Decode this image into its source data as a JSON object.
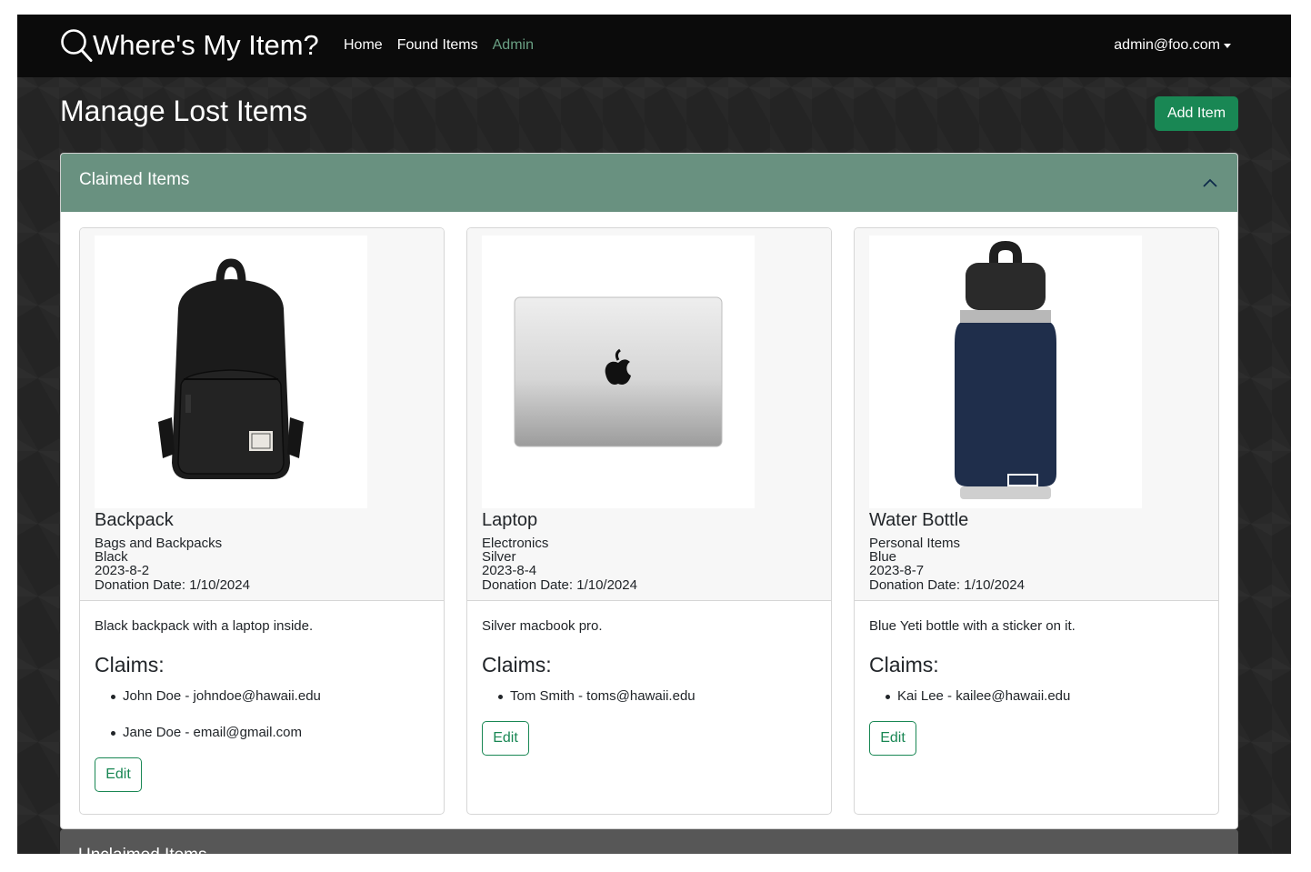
{
  "navbar": {
    "brand": "Where's My Item?",
    "brand_icon": "search-icon",
    "links": [
      {
        "label": "Home",
        "active": false
      },
      {
        "label": "Found Items",
        "active": false
      },
      {
        "label": "Admin",
        "active": true
      }
    ],
    "user": "admin@foo.com",
    "user_icon": "caret-down-icon"
  },
  "page": {
    "title": "Manage Lost Items",
    "add_button": "Add Item"
  },
  "claimed_section": {
    "title": "Claimed Items",
    "expanded": true,
    "toggle_icon": "chevron-up-icon",
    "items": [
      {
        "name": "Backpack",
        "category": "Bags and Backpacks",
        "color": "Black",
        "date": "2023-8-2",
        "donation": "Donation Date: 1/10/2024",
        "description": "Black backpack with a laptop inside.",
        "claims_title": "Claims:",
        "claims": [
          "John Doe - johndoe@hawaii.edu",
          "Jane Doe - email@gmail.com"
        ],
        "edit_label": "Edit",
        "image": "backpack-image"
      },
      {
        "name": "Laptop",
        "category": "Electronics",
        "color": "Silver",
        "date": "2023-8-4",
        "donation": "Donation Date: 1/10/2024",
        "description": "Silver macbook pro.",
        "claims_title": "Claims:",
        "claims": [
          "Tom Smith - toms@hawaii.edu"
        ],
        "edit_label": "Edit",
        "image": "laptop-image"
      },
      {
        "name": "Water Bottle",
        "category": "Personal Items",
        "color": "Blue",
        "date": "2023-8-7",
        "donation": "Donation Date: 1/10/2024",
        "description": "Blue Yeti bottle with a sticker on it.",
        "claims_title": "Claims:",
        "claims": [
          "Kai Lee - kailee@hawaii.edu"
        ],
        "edit_label": "Edit",
        "image": "water-bottle-image"
      }
    ]
  },
  "unclaimed_section": {
    "title": "Unclaimed Items"
  },
  "colors": {
    "navbar_bg": "#0b0b0b",
    "accent_green": "#198754",
    "accordion_header": "#699180",
    "active_link": "#6aa084"
  }
}
